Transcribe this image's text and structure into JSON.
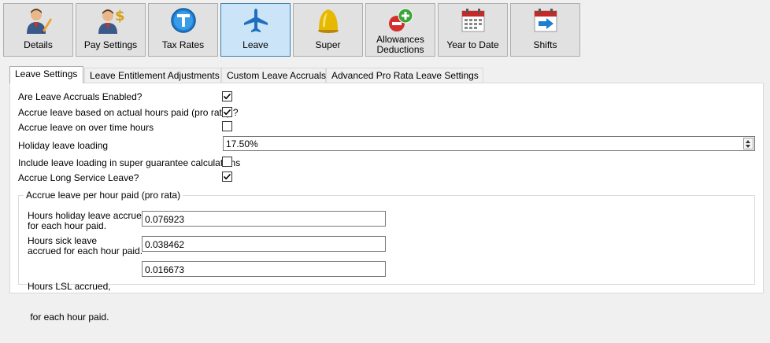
{
  "toolbar": {
    "buttons": [
      {
        "label": "Details",
        "icon": "person-pencil-icon"
      },
      {
        "label": "Pay Settings",
        "icon": "person-dollar-icon"
      },
      {
        "label": "Tax Rates",
        "icon": "tax-t-icon"
      },
      {
        "label": "Leave",
        "icon": "airplane-icon",
        "active": true
      },
      {
        "label": "Super",
        "icon": "gold-bell-icon"
      },
      {
        "label": "Allowances",
        "label2": "Deductions",
        "icon": "plus-minus-icon"
      },
      {
        "label": "Year to Date",
        "icon": "calendar-icon"
      },
      {
        "label": "Shifts",
        "icon": "calendar-arrow-icon"
      }
    ],
    "active_color": "#cce4f7"
  },
  "tabs": [
    {
      "label": "Leave Settings",
      "active": true
    },
    {
      "label": "Leave Entitlement Adjustments"
    },
    {
      "label": "Custom Leave Accruals"
    },
    {
      "label": "Advanced Pro Rata Leave Settings"
    }
  ],
  "settings": {
    "accruals_enabled": {
      "label": "Are Leave Accruals Enabled?",
      "checked": true
    },
    "pro_rata": {
      "label": "Accrue leave based on actual hours paid (pro rata) ?",
      "checked": true
    },
    "overtime": {
      "label": "Accrue leave on over time hours",
      "checked": false
    },
    "holiday_loading": {
      "label": "Holiday leave loading",
      "value": "17.50%"
    },
    "loading_super": {
      "label": "Include leave loading in super guarantee calculations",
      "checked": false
    },
    "long_service": {
      "label": "Accrue Long Service Leave?",
      "checked": true
    }
  },
  "pro_rata_group": {
    "title": "Accrue leave per hour paid (pro rata)",
    "fields": [
      {
        "label1": "Hours holiday leave accrued,",
        "label2": "for each hour paid.",
        "value": "0.076923"
      },
      {
        "label1": "Hours sick leave",
        "label2": "accrued for each hour paid.",
        "value": "0.038462"
      },
      {
        "label1": "Hours LSL accrued,",
        "label2": " for each hour paid.",
        "value": "0.016673"
      }
    ]
  }
}
